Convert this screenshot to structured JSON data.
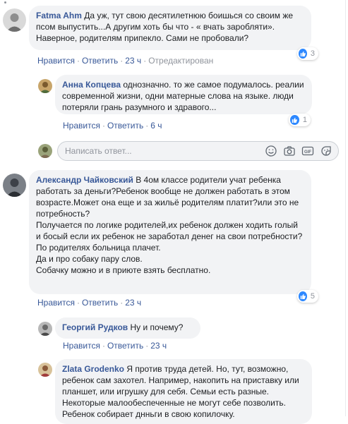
{
  "actions": {
    "like": "Нравится",
    "reply": "Ответить",
    "separator": "·"
  },
  "input": {
    "placeholder": "Написать ответ..."
  },
  "comments": [
    {
      "author": "Fatma Ahm",
      "text": "Да уж, тут свою десятилетнюю боишься со своим же псом выпустить...А другим хоть бы что - « вчать заробляти». Наверное, родителям припекло. Сами не пробовали?",
      "time": "23 ч",
      "edited": "Отредактирован",
      "reactions": "3"
    },
    {
      "author": "Анна Копцева",
      "text": "однозначно. то же самое подумалось. реалии современной жизни, одни матерные слова на языке. люди потеряли грань разумного и здравого...",
      "time": "6 ч",
      "reactions": "1"
    },
    {
      "author": "Александр Чайковский",
      "text_first": "В 4ом классе родители учат ребенка работать за деньги?Ребенок вообще не должен работать в этом возрасте.Может она еще и за жильё родителям платит?или это не потребность?",
      "lines": [
        "Получается по логике родителей,их ребенок должен ходить голый и босый если их ребенок не заработал денег на свои потребности?",
        "По родителях больница плачет.",
        "Да и про собаку пару слов.",
        "Собачку можно и в приюте взять бесплатно."
      ],
      "time": "23 ч",
      "reactions": "5"
    },
    {
      "author": "Георгий Рудков",
      "text": "Ну и почему?",
      "time": "23 ч"
    },
    {
      "author": "Zlata Grodenko",
      "text": "Я против труда детей. Но, тут, возможно, ребенок сам захотел. Например, накопить на приставку или планшет, или игрушку для себя. Семьи есть разные. Некоторые малообеспеченные не могут себе позволить. Ребенок собирает днньги в свою копилочку."
    }
  ],
  "colors": {
    "link": "#385898",
    "meta": "#90949c",
    "bubble": "#f2f3f5",
    "like_blue": "#2d88ff"
  }
}
